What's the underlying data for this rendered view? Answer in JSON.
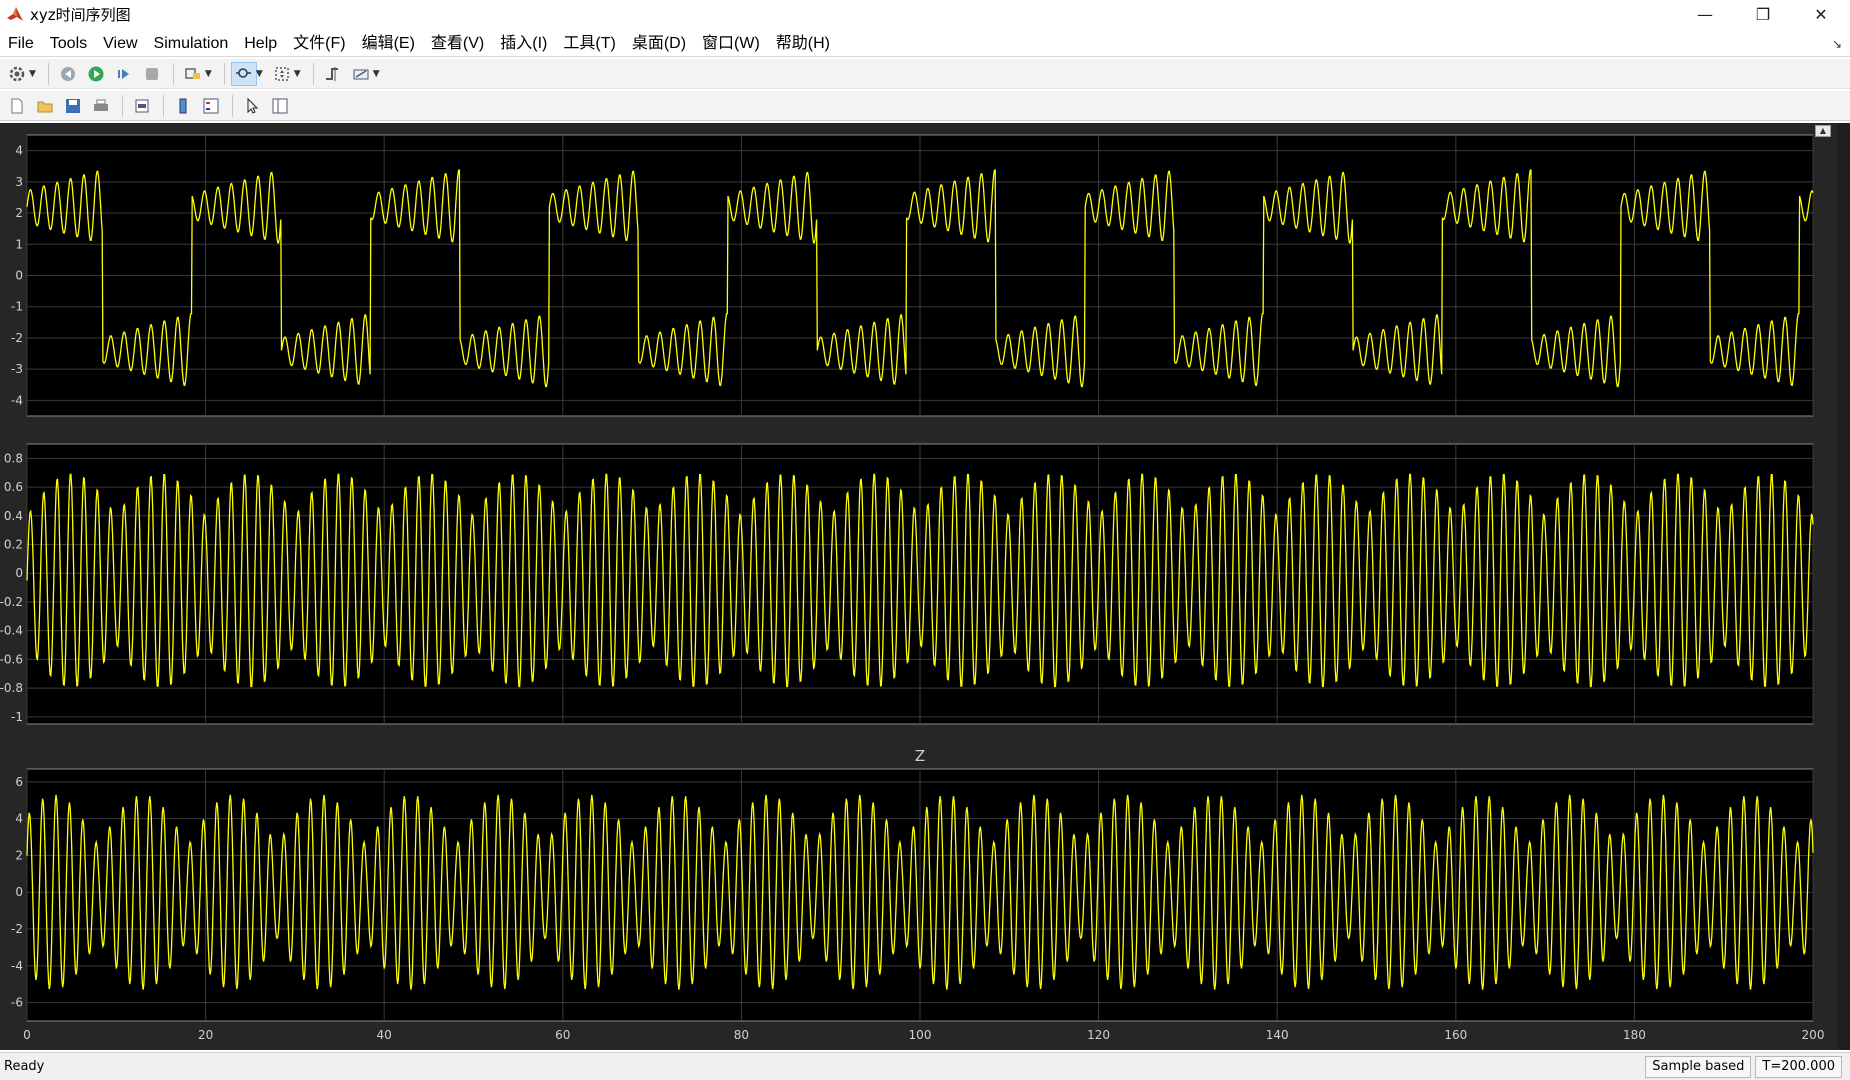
{
  "window": {
    "title": "xyz时间序列图",
    "controls": [
      "minimize-icon",
      "restore-icon",
      "close-icon"
    ]
  },
  "menu": {
    "items": [
      "File",
      "Tools",
      "View",
      "Simulation",
      "Help",
      "文件(F)",
      "编辑(E)",
      "查看(V)",
      "插入(I)",
      "工具(T)",
      "桌面(D)",
      "窗口(W)",
      "帮助(H)"
    ]
  },
  "toolbar1": [
    "settings-icon",
    "step-back-icon",
    "run-icon",
    "step-forward-icon",
    "stop-icon",
    "highlight-icon",
    "zoom-icon",
    "fit-icon",
    "trigger-icon",
    "measure-icon"
  ],
  "toolbar2": [
    "new-figure-icon",
    "open-icon",
    "save-icon",
    "print-icon",
    "link-icon",
    "colorbar-icon",
    "legend-icon",
    "pointer-icon",
    "property-editor-icon"
  ],
  "status": {
    "ready": "Ready",
    "mode": "Sample based",
    "time": "T=200.000"
  },
  "chart_data": [
    {
      "type": "line",
      "title": "",
      "xlim": [
        0,
        200
      ],
      "ylim": [
        -4.5,
        4.5
      ],
      "yticks": [
        "4",
        "3",
        "2",
        "1",
        "0",
        "-1",
        "-2",
        "-3",
        "-4"
      ],
      "grid": true,
      "series": [
        {
          "color": "#ffff00",
          "description": "oscillating x signal switching between two lobes near +2 and -2.5, amplitude about ±3.8"
        }
      ]
    },
    {
      "type": "line",
      "title": "",
      "xlim": [
        0,
        200
      ],
      "ylim": [
        -1.05,
        0.9
      ],
      "yticks": [
        "0.8",
        "0.6",
        "0.4",
        "0.2",
        "0",
        "-0.2",
        "-0.4",
        "-0.6",
        "-0.8",
        "-1"
      ],
      "grid": true,
      "series": [
        {
          "color": "#ffff00",
          "description": "fast oscillating y signal, amplitude about ±0.8"
        }
      ]
    },
    {
      "type": "line",
      "title": "Z",
      "xlim": [
        0,
        200
      ],
      "ylim": [
        -7,
        6.7
      ],
      "yticks": [
        "6",
        "4",
        "2",
        "0",
        "-2",
        "-4",
        "-6"
      ],
      "xticks": [
        "0",
        "20",
        "40",
        "60",
        "80",
        "100",
        "120",
        "140",
        "160",
        "180",
        "200"
      ],
      "grid": true,
      "series": [
        {
          "color": "#ffff00",
          "description": "oscillating z signal, amplitude about ±5.5"
        }
      ]
    }
  ]
}
